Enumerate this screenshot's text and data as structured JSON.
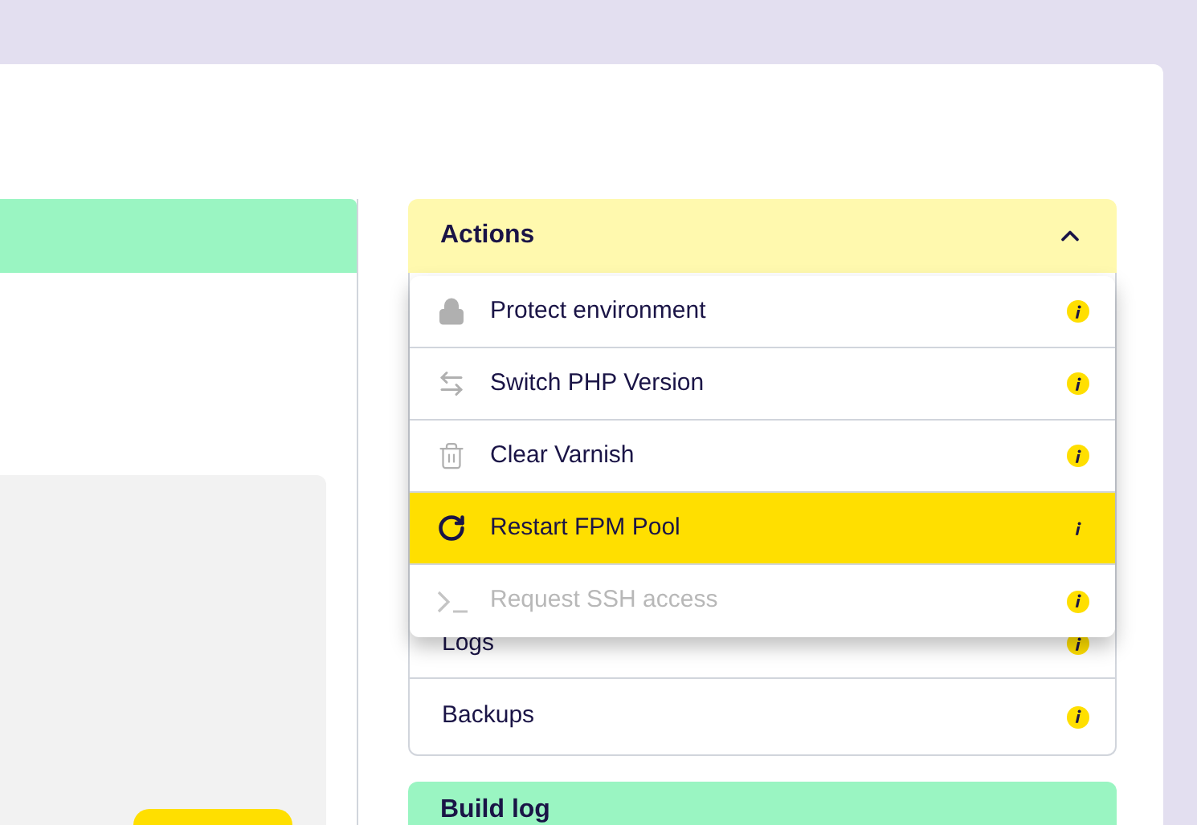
{
  "actions_panel": {
    "title": "Actions",
    "expanded": true,
    "menu": [
      {
        "label": "Protect environment",
        "kind": "lock",
        "selected": false,
        "disabled": false
      },
      {
        "label": "Switch PHP Version",
        "kind": "swap",
        "selected": false,
        "disabled": false
      },
      {
        "label": "Clear Varnish",
        "kind": "trash",
        "selected": false,
        "disabled": false
      },
      {
        "label": "Restart FPM Pool",
        "kind": "restart",
        "selected": true,
        "disabled": false
      },
      {
        "label": "Request SSH access",
        "kind": "terminal",
        "selected": false,
        "disabled": true
      }
    ],
    "items": [
      {
        "label": "Logs"
      },
      {
        "label": "Backups"
      }
    ]
  },
  "build_log": {
    "title": "Build log"
  }
}
